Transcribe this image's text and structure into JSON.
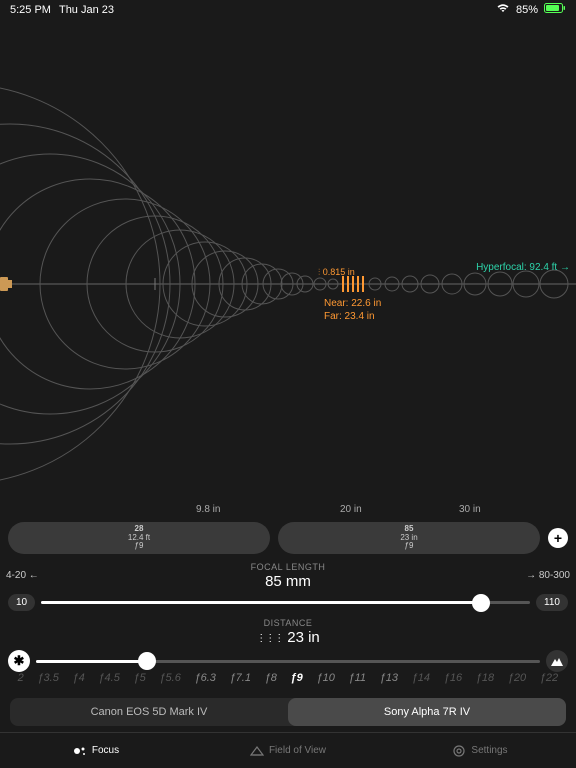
{
  "status": {
    "time": "5:25 PM",
    "date": "Thu Jan 23",
    "battery": "85%"
  },
  "hyperfocal": "Hyperfocal: 92.4 ft →",
  "focus_bracket": {
    "total": "⫶ 0.815 in",
    "near": "Near: 22.6 in",
    "far": "Far: 23.4 in"
  },
  "dist_ticks": {
    "a": "9.8 in",
    "b": "20 in",
    "c": "30 in"
  },
  "presets": [
    {
      "focal": "28",
      "dist": "12.4 ft",
      "ap": "ƒ9"
    },
    {
      "focal": "85",
      "dist": "23 in",
      "ap": "ƒ9"
    }
  ],
  "ranges": {
    "left": "4-20 ←",
    "right": "→ 80-300"
  },
  "focal": {
    "title": "FOCAL LENGTH",
    "value": "85 mm",
    "min": "10",
    "max": "110",
    "pct": 90
  },
  "distance": {
    "title": "DISTANCE",
    "value": "23 in",
    "pct": 22
  },
  "apertures": [
    "2",
    "ƒ3.5",
    "ƒ4",
    "ƒ4.5",
    "ƒ5",
    "ƒ5.6",
    "ƒ6.3",
    "ƒ7.1",
    "ƒ8",
    "ƒ9",
    "ƒ10",
    "ƒ11",
    "ƒ13",
    "ƒ14",
    "ƒ16",
    "ƒ18",
    "ƒ20",
    "ƒ22"
  ],
  "aperture_active_index": 9,
  "cameras": {
    "a": "Canon EOS 5D Mark IV",
    "b": "Sony Alpha 7R IV"
  },
  "tabs": {
    "focus": "Focus",
    "fov": "Field of View",
    "settings": "Settings"
  }
}
